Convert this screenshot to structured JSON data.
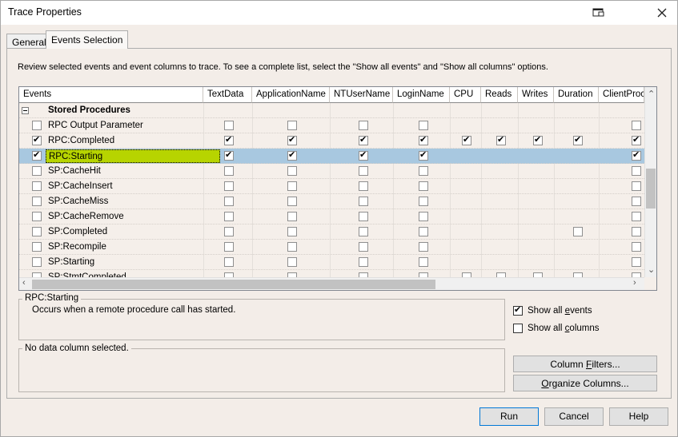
{
  "window": {
    "title": "Trace Properties"
  },
  "tabs": [
    {
      "label": "General"
    },
    {
      "label": "Events Selection"
    }
  ],
  "description": "Review selected events and event columns to trace. To see a complete list, select the \"Show all events\" and \"Show all columns\" options.",
  "grid": {
    "columns": [
      "Events",
      "TextData",
      "ApplicationName",
      "NTUserName",
      "LoginName",
      "CPU",
      "Reads",
      "Writes",
      "Duration",
      "ClientProce"
    ],
    "group": "Stored Procedures",
    "rows": [
      {
        "label": "RPC Output Parameter",
        "checked": false,
        "cells": [
          false,
          false,
          false,
          false,
          null,
          null,
          null,
          null,
          false
        ]
      },
      {
        "label": "RPC:Completed",
        "checked": true,
        "cells": [
          true,
          true,
          true,
          true,
          true,
          true,
          true,
          true,
          true
        ]
      },
      {
        "label": "RPC:Starting",
        "checked": true,
        "selected": true,
        "cells": [
          true,
          true,
          true,
          true,
          null,
          null,
          null,
          null,
          true
        ]
      },
      {
        "label": "SP:CacheHit",
        "checked": false,
        "cells": [
          false,
          false,
          false,
          false,
          null,
          null,
          null,
          null,
          false
        ]
      },
      {
        "label": "SP:CacheInsert",
        "checked": false,
        "cells": [
          false,
          false,
          false,
          false,
          null,
          null,
          null,
          null,
          false
        ]
      },
      {
        "label": "SP:CacheMiss",
        "checked": false,
        "cells": [
          false,
          false,
          false,
          false,
          null,
          null,
          null,
          null,
          false
        ]
      },
      {
        "label": "SP:CacheRemove",
        "checked": false,
        "cells": [
          false,
          false,
          false,
          false,
          null,
          null,
          null,
          null,
          false
        ]
      },
      {
        "label": "SP:Completed",
        "checked": false,
        "cells": [
          false,
          false,
          false,
          false,
          null,
          null,
          null,
          false,
          false
        ]
      },
      {
        "label": "SP:Recompile",
        "checked": false,
        "cells": [
          false,
          false,
          false,
          false,
          null,
          null,
          null,
          null,
          false
        ]
      },
      {
        "label": "SP:Starting",
        "checked": false,
        "cells": [
          false,
          false,
          false,
          false,
          null,
          null,
          null,
          null,
          false
        ]
      },
      {
        "label": "SP:StmtCompleted",
        "checked": false,
        "cells": [
          false,
          false,
          false,
          false,
          false,
          false,
          false,
          false,
          false
        ]
      }
    ]
  },
  "event_box": {
    "title": "RPC:Starting",
    "text": "Occurs when a remote procedure call has started."
  },
  "column_box": {
    "title": "No data column selected."
  },
  "options": {
    "show_all_events": {
      "prefix": "Show all ",
      "accel": "e",
      "suffix": "vents",
      "checked": true
    },
    "show_all_columns": {
      "prefix": "Show all ",
      "accel": "c",
      "suffix": "olumns",
      "checked": false
    }
  },
  "side_buttons": {
    "column_filters": {
      "prefix": "Column ",
      "accel": "F",
      "suffix": "ilters..."
    },
    "organize_columns": {
      "prefix": "",
      "accel": "O",
      "suffix": "rganize Columns..."
    }
  },
  "footer": {
    "run": "Run",
    "cancel": "Cancel",
    "help": "Help"
  },
  "colors": {
    "selection": "#a8c8e0",
    "highlight": "#b7d400",
    "accent": "#0078d7"
  }
}
